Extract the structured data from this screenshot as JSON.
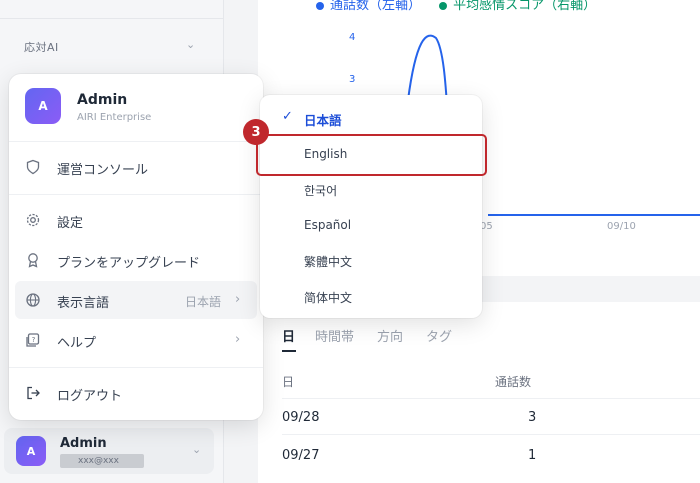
{
  "sidebar": {
    "section_label": "応対AI",
    "user": {
      "initial": "A",
      "name": "Admin",
      "email": "xxx@xxx"
    }
  },
  "chart": {
    "legend": [
      {
        "label": "通話数（左軸）",
        "color": "#2563eb"
      },
      {
        "label": "平均感情スコア（右軸）",
        "color": "#059669"
      }
    ],
    "y_ticks": [
      "4",
      "3"
    ],
    "x_ticks": [
      "05",
      "09/10"
    ]
  },
  "chart_data": {
    "type": "line",
    "series": [
      {
        "name": "通話数（左軸）",
        "color": "#2563eb"
      },
      {
        "name": "平均感情スコア（右軸）",
        "color": "#059669"
      }
    ],
    "y_ticks": [
      4,
      3
    ],
    "x_ticks": [
      "05",
      "09/10"
    ]
  },
  "table": {
    "tabs": [
      "日",
      "時間帯",
      "方向",
      "タグ"
    ],
    "headers": {
      "date": "日",
      "calls": "通話数"
    },
    "rows": [
      {
        "date": "09/28",
        "calls": "3"
      },
      {
        "date": "09/27",
        "calls": "1"
      }
    ]
  },
  "account_menu": {
    "initial": "A",
    "name": "Admin",
    "org": "AIRI Enterprise",
    "items": [
      {
        "label": "運営コンソール"
      },
      {
        "label": "設定"
      },
      {
        "label": "プランをアップグレード"
      },
      {
        "label": "表示言語",
        "value": "日本語"
      },
      {
        "label": "ヘルプ"
      },
      {
        "label": "ログアウト"
      }
    ]
  },
  "language_menu": {
    "selected": "日本語",
    "options": [
      "日本語",
      "English",
      "한국어",
      "Español",
      "繁體中文",
      "简体中文"
    ]
  },
  "annotation": {
    "step": "3",
    "color": "#c0282d"
  }
}
